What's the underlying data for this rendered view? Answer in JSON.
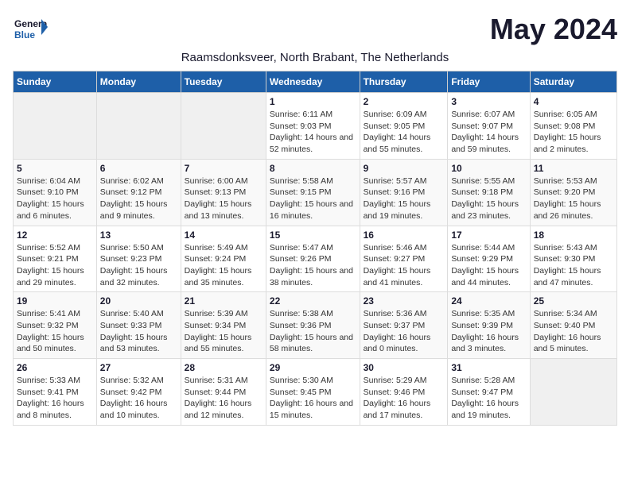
{
  "header": {
    "logo_general": "General",
    "logo_blue": "Blue",
    "month_title": "May 2024",
    "subtitle": "Raamsdonksveer, North Brabant, The Netherlands"
  },
  "columns": [
    "Sunday",
    "Monday",
    "Tuesday",
    "Wednesday",
    "Thursday",
    "Friday",
    "Saturday"
  ],
  "weeks": [
    {
      "days": [
        {
          "empty": true
        },
        {
          "empty": true
        },
        {
          "empty": true
        },
        {
          "num": "1",
          "sunrise": "6:11 AM",
          "sunset": "9:03 PM",
          "daylight": "14 hours and 52 minutes."
        },
        {
          "num": "2",
          "sunrise": "6:09 AM",
          "sunset": "9:05 PM",
          "daylight": "14 hours and 55 minutes."
        },
        {
          "num": "3",
          "sunrise": "6:07 AM",
          "sunset": "9:07 PM",
          "daylight": "14 hours and 59 minutes."
        },
        {
          "num": "4",
          "sunrise": "6:05 AM",
          "sunset": "9:08 PM",
          "daylight": "15 hours and 2 minutes."
        }
      ]
    },
    {
      "days": [
        {
          "num": "5",
          "sunrise": "6:04 AM",
          "sunset": "9:10 PM",
          "daylight": "15 hours and 6 minutes."
        },
        {
          "num": "6",
          "sunrise": "6:02 AM",
          "sunset": "9:12 PM",
          "daylight": "15 hours and 9 minutes."
        },
        {
          "num": "7",
          "sunrise": "6:00 AM",
          "sunset": "9:13 PM",
          "daylight": "15 hours and 13 minutes."
        },
        {
          "num": "8",
          "sunrise": "5:58 AM",
          "sunset": "9:15 PM",
          "daylight": "15 hours and 16 minutes."
        },
        {
          "num": "9",
          "sunrise": "5:57 AM",
          "sunset": "9:16 PM",
          "daylight": "15 hours and 19 minutes."
        },
        {
          "num": "10",
          "sunrise": "5:55 AM",
          "sunset": "9:18 PM",
          "daylight": "15 hours and 23 minutes."
        },
        {
          "num": "11",
          "sunrise": "5:53 AM",
          "sunset": "9:20 PM",
          "daylight": "15 hours and 26 minutes."
        }
      ]
    },
    {
      "days": [
        {
          "num": "12",
          "sunrise": "5:52 AM",
          "sunset": "9:21 PM",
          "daylight": "15 hours and 29 minutes."
        },
        {
          "num": "13",
          "sunrise": "5:50 AM",
          "sunset": "9:23 PM",
          "daylight": "15 hours and 32 minutes."
        },
        {
          "num": "14",
          "sunrise": "5:49 AM",
          "sunset": "9:24 PM",
          "daylight": "15 hours and 35 minutes."
        },
        {
          "num": "15",
          "sunrise": "5:47 AM",
          "sunset": "9:26 PM",
          "daylight": "15 hours and 38 minutes."
        },
        {
          "num": "16",
          "sunrise": "5:46 AM",
          "sunset": "9:27 PM",
          "daylight": "15 hours and 41 minutes."
        },
        {
          "num": "17",
          "sunrise": "5:44 AM",
          "sunset": "9:29 PM",
          "daylight": "15 hours and 44 minutes."
        },
        {
          "num": "18",
          "sunrise": "5:43 AM",
          "sunset": "9:30 PM",
          "daylight": "15 hours and 47 minutes."
        }
      ]
    },
    {
      "days": [
        {
          "num": "19",
          "sunrise": "5:41 AM",
          "sunset": "9:32 PM",
          "daylight": "15 hours and 50 minutes."
        },
        {
          "num": "20",
          "sunrise": "5:40 AM",
          "sunset": "9:33 PM",
          "daylight": "15 hours and 53 minutes."
        },
        {
          "num": "21",
          "sunrise": "5:39 AM",
          "sunset": "9:34 PM",
          "daylight": "15 hours and 55 minutes."
        },
        {
          "num": "22",
          "sunrise": "5:38 AM",
          "sunset": "9:36 PM",
          "daylight": "15 hours and 58 minutes."
        },
        {
          "num": "23",
          "sunrise": "5:36 AM",
          "sunset": "9:37 PM",
          "daylight": "16 hours and 0 minutes."
        },
        {
          "num": "24",
          "sunrise": "5:35 AM",
          "sunset": "9:39 PM",
          "daylight": "16 hours and 3 minutes."
        },
        {
          "num": "25",
          "sunrise": "5:34 AM",
          "sunset": "9:40 PM",
          "daylight": "16 hours and 5 minutes."
        }
      ]
    },
    {
      "days": [
        {
          "num": "26",
          "sunrise": "5:33 AM",
          "sunset": "9:41 PM",
          "daylight": "16 hours and 8 minutes."
        },
        {
          "num": "27",
          "sunrise": "5:32 AM",
          "sunset": "9:42 PM",
          "daylight": "16 hours and 10 minutes."
        },
        {
          "num": "28",
          "sunrise": "5:31 AM",
          "sunset": "9:44 PM",
          "daylight": "16 hours and 12 minutes."
        },
        {
          "num": "29",
          "sunrise": "5:30 AM",
          "sunset": "9:45 PM",
          "daylight": "16 hours and 15 minutes."
        },
        {
          "num": "30",
          "sunrise": "5:29 AM",
          "sunset": "9:46 PM",
          "daylight": "16 hours and 17 minutes."
        },
        {
          "num": "31",
          "sunrise": "5:28 AM",
          "sunset": "9:47 PM",
          "daylight": "16 hours and 19 minutes."
        },
        {
          "empty": true
        }
      ]
    }
  ]
}
